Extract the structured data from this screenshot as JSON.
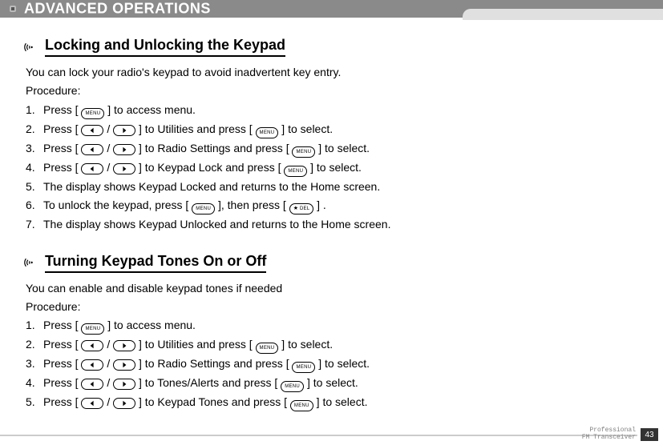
{
  "header": {
    "title": "ADVANCED OPERATIONS"
  },
  "keys": {
    "menu": "MENU",
    "del": "DEL"
  },
  "sections": [
    {
      "title": "Locking and Unlocking the Keypad",
      "intro": "You can lock your radio's keypad to avoid inadvertent key entry.",
      "procedure_label": "Procedure:",
      "steps": [
        {
          "pre": "Press [ ",
          "seq": [
            "menu"
          ],
          "post": " ] to access menu."
        },
        {
          "pre": "Press [ ",
          "seq": [
            "left",
            " / ",
            "right"
          ],
          "mid": " ] to Utilities and press [ ",
          "seq2": [
            "menu"
          ],
          "post": " ] to select."
        },
        {
          "pre": "Press [ ",
          "seq": [
            "left",
            " / ",
            "right"
          ],
          "mid": " ] to Radio Settings and press [ ",
          "seq2": [
            "menu"
          ],
          "post": " ] to select."
        },
        {
          "pre": "Press [ ",
          "seq": [
            "left",
            " / ",
            "right"
          ],
          "mid": " ] to Keypad Lock and press [ ",
          "seq2": [
            "menu"
          ],
          "post": " ] to select."
        },
        {
          "text": "The display shows Keypad Locked and returns to the Home screen."
        },
        {
          "pre": "To unlock the keypad, press [ ",
          "seq": [
            "menu"
          ],
          "mid": " ], then press  [ ",
          "seq2": [
            "del"
          ],
          "post": " ] ."
        },
        {
          "text": "The display shows Keypad Unlocked and returns to the Home screen."
        }
      ]
    },
    {
      "title": "Turning Keypad Tones On or Off",
      "intro": "You can enable and disable keypad tones if needed",
      "procedure_label": "Procedure:",
      "steps": [
        {
          "pre": "Press [ ",
          "seq": [
            "menu"
          ],
          "post": " ] to access menu."
        },
        {
          "pre": "Press [ ",
          "seq": [
            "left",
            " / ",
            "right"
          ],
          "mid": " ] to Utilities and press [ ",
          "seq2": [
            "menu"
          ],
          "post": " ] to select."
        },
        {
          "pre": "Press [ ",
          "seq": [
            "left",
            " / ",
            "right"
          ],
          "mid": " ] to Radio Settings and press [ ",
          "seq2": [
            "menu"
          ],
          "post": " ] to select."
        },
        {
          "pre": "Press [ ",
          "seq": [
            "left",
            " / ",
            "right"
          ],
          "mid": " ] to Tones/Alerts and press [ ",
          "seq2": [
            "menu"
          ],
          "post": " ] to select."
        },
        {
          "pre": "Press [ ",
          "seq": [
            "left",
            " / ",
            "right"
          ],
          "mid": " ] to Keypad Tones and press [ ",
          "seq2": [
            "menu"
          ],
          "post": " ]  to select."
        }
      ]
    }
  ],
  "footer": {
    "line1": "Professional",
    "line2": "FM Transceiver",
    "page": "43"
  }
}
